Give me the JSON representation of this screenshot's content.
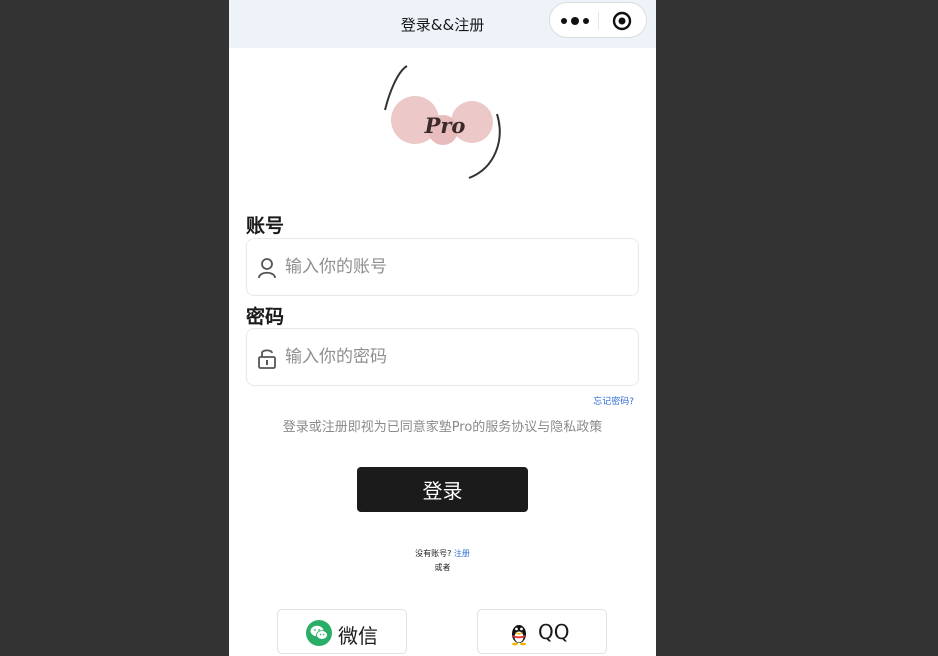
{
  "navbar": {
    "title": "登录&&注册",
    "more_icon": "more-dots-icon",
    "close_icon": "target-close-icon"
  },
  "logo": {
    "text": "Pro",
    "circle_color": "#ecc8c8"
  },
  "account": {
    "label": "账号",
    "placeholder": "输入你的账号",
    "icon": "user-icon"
  },
  "password": {
    "label": "密码",
    "placeholder": "输入你的密码",
    "icon": "lock-icon"
  },
  "forgot_password": "忘记密码?",
  "agreement": "登录或注册即视为已同意家塾Pro的服务协议与隐私政策",
  "login_button": "登录",
  "register": {
    "prompt": "没有账号?",
    "link": "注册"
  },
  "or_text": "或者",
  "social": {
    "wechat_label": "微信",
    "qq_label": "QQ",
    "wechat_color": "#2aae67"
  }
}
